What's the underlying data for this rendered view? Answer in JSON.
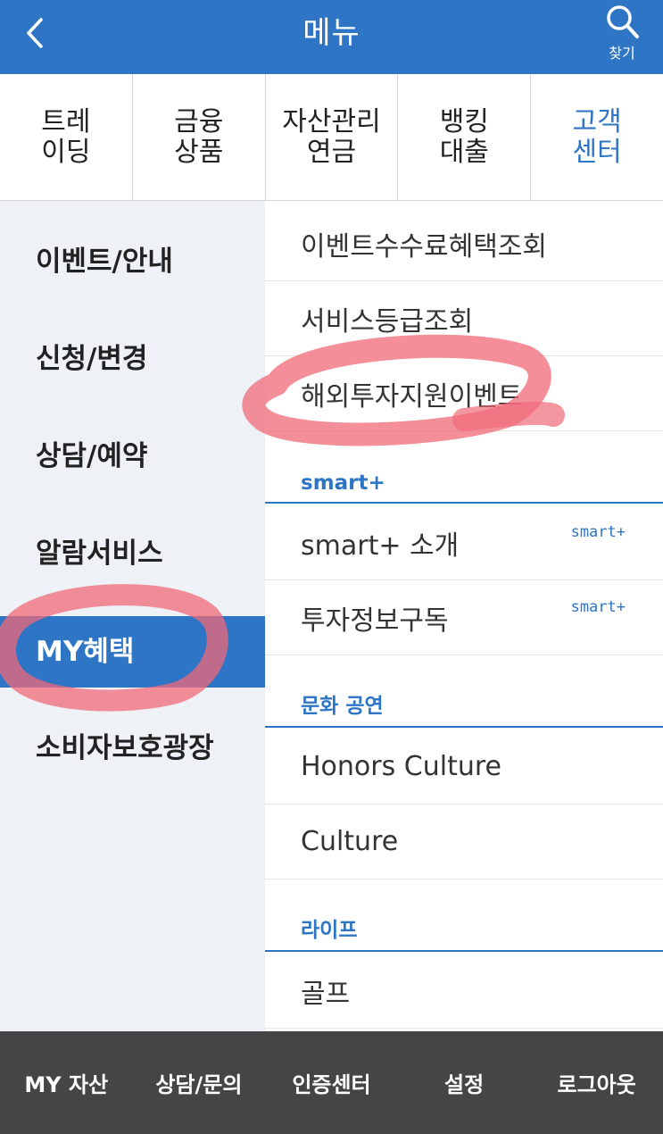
{
  "header": {
    "title": "메뉴",
    "search_label": "찾기"
  },
  "tabs": [
    {
      "label": "트레\n이딩",
      "active": false
    },
    {
      "label": "금융\n상품",
      "active": false
    },
    {
      "label": "자산관리\n연금",
      "active": false
    },
    {
      "label": "뱅킹\n대출",
      "active": false
    },
    {
      "label": "고객\n센터",
      "active": true
    }
  ],
  "categories": [
    {
      "label": "이벤트/안내",
      "active": false
    },
    {
      "label": "신청/변경",
      "active": false
    },
    {
      "label": "상담/예약",
      "active": false
    },
    {
      "label": "알람서비스",
      "active": false
    },
    {
      "label": "MY혜택",
      "active": true
    },
    {
      "label": "소비자보호광장",
      "active": false
    }
  ],
  "submenu": {
    "items_top": [
      "이벤트수수료혜택조회",
      "서비스등급조회",
      "해외투자지원이벤트"
    ],
    "section_smart": "smart+",
    "items_smart": [
      {
        "label": "smart+ 소개",
        "badge": "smart+"
      },
      {
        "label": "투자정보구독",
        "badge": "smart+"
      }
    ],
    "section_culture": "문화 공연",
    "items_culture": [
      "Honors Culture",
      "Culture"
    ],
    "section_life": "라이프",
    "items_life": [
      "골프"
    ]
  },
  "bottom_bar": [
    "MY 자산",
    "상담/문의",
    "인증센터",
    "설정",
    "로그아웃"
  ],
  "colors": {
    "primary": "#2f75c5",
    "left_panel_bg": "#eef2f7",
    "bottom_bar_bg": "#454545",
    "highlighter": "#f06a78"
  }
}
